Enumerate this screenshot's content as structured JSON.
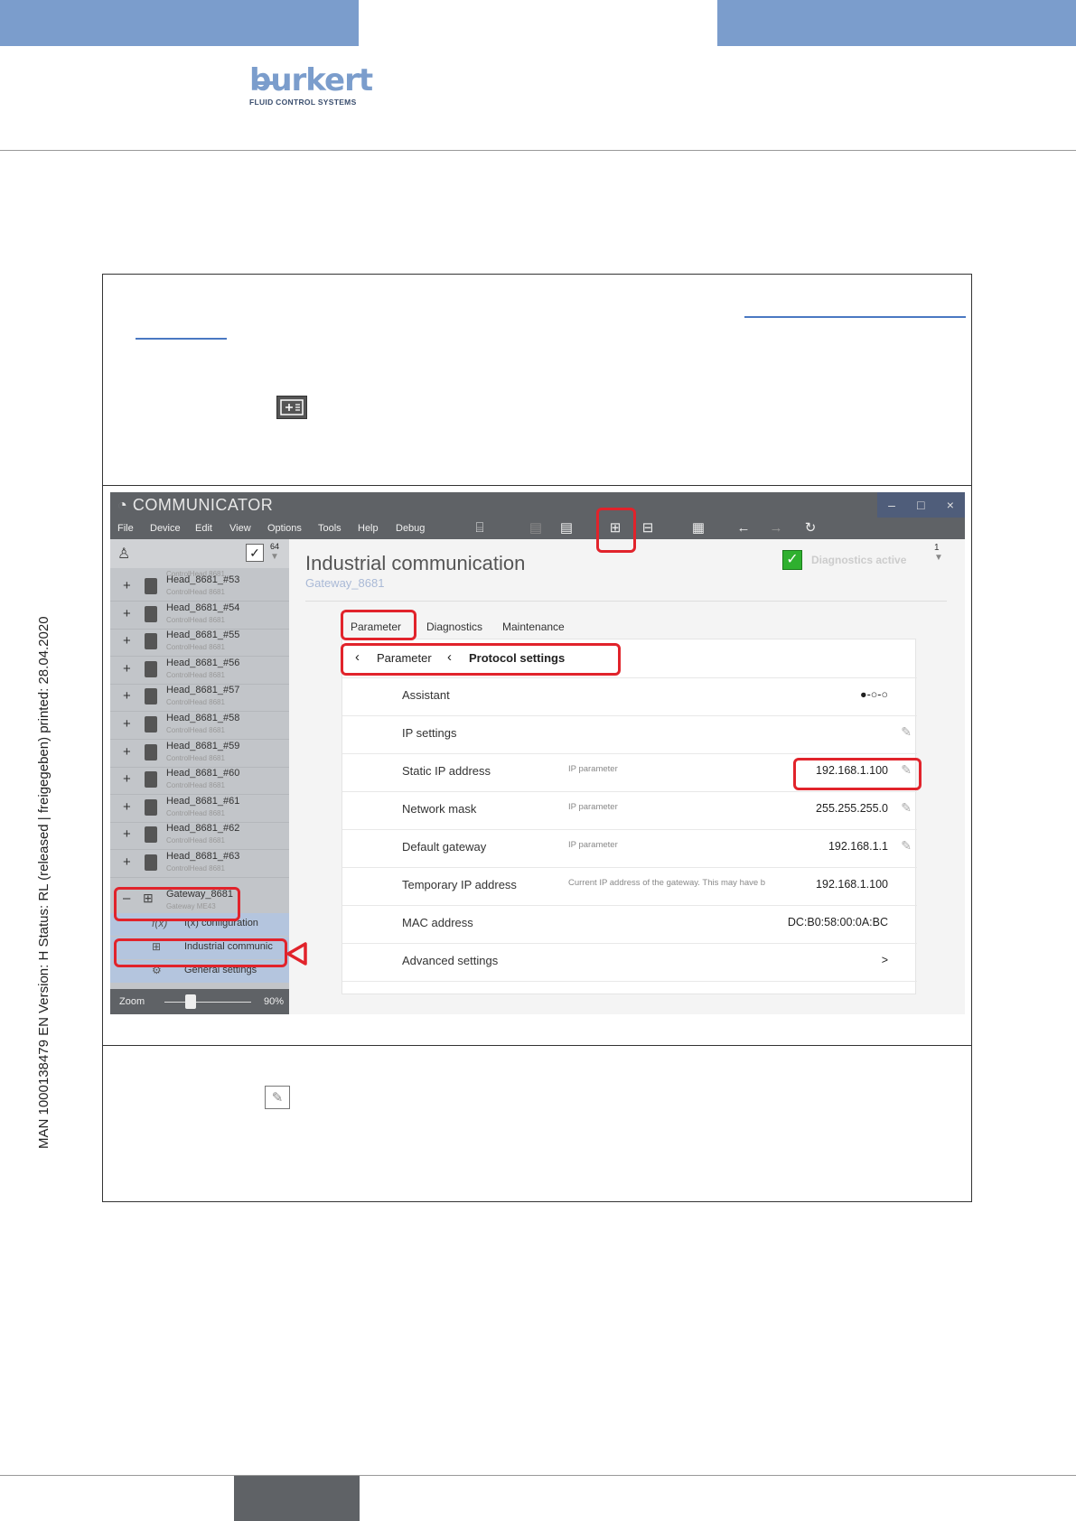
{
  "logo": {
    "word": "burkert",
    "tagline": "FLUID CONTROL SYSTEMS"
  },
  "side_text": "MAN  1000138479  EN  Version: H Status: RL (released | freigegeben)  printed: 28.04.2020",
  "app": {
    "title": "COMMUNICATOR",
    "window_buttons": [
      "–",
      "□",
      "×"
    ],
    "menu": [
      "File",
      "Device",
      "Edit",
      "View",
      "Options",
      "Tools",
      "Help",
      "Debug"
    ],
    "tree_count": "64",
    "tree": [
      {
        "name": "Head_8681_#53",
        "type": "ControlHead 8681"
      },
      {
        "name": "Head_8681_#54",
        "type": "ControlHead 8681"
      },
      {
        "name": "Head_8681_#55",
        "type": "ControlHead 8681"
      },
      {
        "name": "Head_8681_#56",
        "type": "ControlHead 8681"
      },
      {
        "name": "Head_8681_#57",
        "type": "ControlHead 8681"
      },
      {
        "name": "Head_8681_#58",
        "type": "ControlHead 8681"
      },
      {
        "name": "Head_8681_#59",
        "type": "ControlHead 8681"
      },
      {
        "name": "Head_8681_#60",
        "type": "ControlHead 8681"
      },
      {
        "name": "Head_8681_#61",
        "type": "ControlHead 8681"
      },
      {
        "name": "Head_8681_#62",
        "type": "ControlHead 8681"
      },
      {
        "name": "Head_8681_#63",
        "type": "ControlHead 8681"
      }
    ],
    "tree_top_type": "ControlHead 8681",
    "gateway": {
      "name": "Gateway_8681",
      "type": "Gateway ME43"
    },
    "subnodes": [
      "f(x) configuration",
      "Industrial communic",
      "General settings"
    ],
    "zoom_label": "Zoom",
    "zoom_value": "90%",
    "zoom_fraction": 0.3,
    "main_title": "Industrial communication",
    "main_subtitle": "Gateway_8681",
    "diagnostics_text": "Diagnostics active",
    "diagnostics_count": "1",
    "tabs": [
      "Parameter",
      "Diagnostics",
      "Maintenance"
    ],
    "breadcrumb": [
      "Parameter",
      "Protocol settings"
    ],
    "params": [
      {
        "label": "Assistant",
        "desc": "",
        "value": "●-○-○",
        "edit": false
      },
      {
        "label": "IP settings",
        "desc": "",
        "value": "",
        "edit": true
      },
      {
        "label": "Static IP address",
        "desc": "IP parameter",
        "value": "192.168.1.100",
        "edit": true
      },
      {
        "label": "Network mask",
        "desc": "IP parameter",
        "value": "255.255.255.0",
        "edit": true
      },
      {
        "label": "Default gateway",
        "desc": "IP parameter",
        "value": "192.168.1.1",
        "edit": true
      },
      {
        "label": "Temporary IP address",
        "desc": "Current IP address of the gateway. This may have been assigned e.g. by the controller or a",
        "value": "192.168.1.100",
        "edit": false
      },
      {
        "label": "MAC address",
        "desc": "",
        "value": "DC:B0:58:00:0A:BC",
        "edit": false
      },
      {
        "label": "Advanced settings",
        "desc": "",
        "value": ">",
        "edit": false
      }
    ]
  },
  "colors": {
    "brand": "#7b9dcc",
    "highlight": "#e1232b",
    "ok": "#2fb02f"
  }
}
